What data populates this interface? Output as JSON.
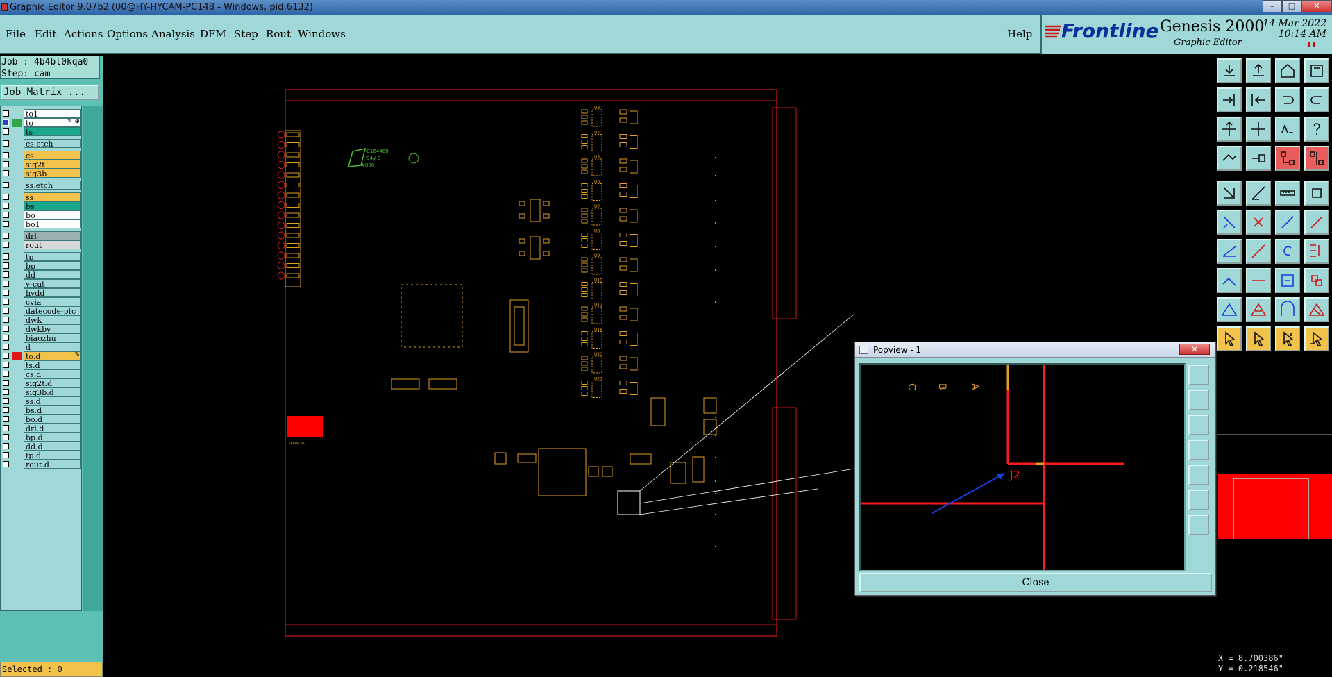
{
  "window": {
    "title": "Graphic Editor 9.07b2 (00@HY-HYCAM-PC148 - Windows, pid:6132)",
    "controls": [
      "–",
      "□",
      "✕"
    ]
  },
  "menu": {
    "items": [
      "File",
      "Edit",
      "Actions",
      "Options",
      "Analysis",
      "DFM",
      "Step",
      "Rout",
      "Windows"
    ],
    "help": "Help"
  },
  "brand": {
    "logo": "Frontline",
    "product": "Genesis 2000",
    "subtitle": "Graphic Editor",
    "date": "14 Mar 2022",
    "time": "10:14 AM"
  },
  "job": {
    "job_line": "Job : 4b4bl0kqa0",
    "step_line": "Step: cam",
    "matrix_button": "Job Matrix ..."
  },
  "layers": [
    {
      "name": "to1",
      "color": "#ffffff",
      "swatch": "",
      "checked": false,
      "gap": false
    },
    {
      "name": "to",
      "color": "#ffffff",
      "swatch": "#2fa84a",
      "checked": true,
      "gap": false,
      "edit": "✎ ⊕"
    },
    {
      "name": "ts",
      "color": "#1aa88a",
      "swatch": "",
      "checked": false,
      "gap": false
    },
    {
      "name": "cs.etch",
      "color": "#9fd8d6",
      "swatch": "",
      "checked": false,
      "gap": true
    },
    {
      "name": "cs",
      "color": "#f2c24a",
      "swatch": "",
      "checked": false,
      "gap": true
    },
    {
      "name": "sig2t",
      "color": "#f2c24a",
      "swatch": "",
      "checked": false,
      "gap": false
    },
    {
      "name": "sig3b",
      "color": "#f2c24a",
      "swatch": "",
      "checked": false,
      "gap": false
    },
    {
      "name": "ss.etch",
      "color": "#9fd8d6",
      "swatch": "",
      "checked": false,
      "gap": true
    },
    {
      "name": "ss",
      "color": "#f2c24a",
      "swatch": "",
      "checked": false,
      "gap": true
    },
    {
      "name": "bs",
      "color": "#1aa88a",
      "swatch": "",
      "checked": false,
      "gap": false
    },
    {
      "name": "bo",
      "color": "#ffffff",
      "swatch": "",
      "checked": false,
      "gap": false
    },
    {
      "name": "bo1",
      "color": "#ffffff",
      "swatch": "",
      "checked": false,
      "gap": false
    },
    {
      "name": "drl",
      "color": "#9ab0b0",
      "swatch": "",
      "checked": false,
      "gap": true
    },
    {
      "name": "rout",
      "color": "#d8d8d8",
      "swatch": "",
      "checked": false,
      "gap": false
    },
    {
      "name": "tp",
      "color": "#9fd8d6",
      "swatch": "",
      "checked": false,
      "gap": true
    },
    {
      "name": "bp",
      "color": "#9fd8d6",
      "swatch": "",
      "checked": false,
      "gap": false
    },
    {
      "name": "dd",
      "color": "#9fd8d6",
      "swatch": "",
      "checked": false,
      "gap": false
    },
    {
      "name": "v-cut",
      "color": "#9fd8d6",
      "swatch": "",
      "checked": false,
      "gap": false
    },
    {
      "name": "hydd",
      "color": "#9fd8d6",
      "swatch": "",
      "checked": false,
      "gap": false
    },
    {
      "name": "cvia",
      "color": "#9fd8d6",
      "swatch": "",
      "checked": false,
      "gap": false
    },
    {
      "name": "datecode-ptc",
      "color": "#9fd8d6",
      "swatch": "",
      "checked": false,
      "gap": false
    },
    {
      "name": "dwk",
      "color": "#9fd8d6",
      "swatch": "",
      "checked": false,
      "gap": false
    },
    {
      "name": "dwkby",
      "color": "#9fd8d6",
      "swatch": "",
      "checked": false,
      "gap": false
    },
    {
      "name": "biaozhu",
      "color": "#9fd8d6",
      "swatch": "",
      "checked": false,
      "gap": false
    },
    {
      "name": "d",
      "color": "#9fd8d6",
      "swatch": "",
      "checked": false,
      "gap": false
    },
    {
      "name": "to.d",
      "color": "#f2c24a",
      "swatch": "#e01818",
      "checked": false,
      "gap": false,
      "edit": "✎"
    },
    {
      "name": "ts.d",
      "color": "#9fd8d6",
      "swatch": "",
      "checked": false,
      "gap": false
    },
    {
      "name": "cs.d",
      "color": "#9fd8d6",
      "swatch": "",
      "checked": false,
      "gap": false
    },
    {
      "name": "sig2t.d",
      "color": "#9fd8d6",
      "swatch": "",
      "checked": false,
      "gap": false
    },
    {
      "name": "sig3b.d",
      "color": "#9fd8d6",
      "swatch": "",
      "checked": false,
      "gap": false
    },
    {
      "name": "ss.d",
      "color": "#9fd8d6",
      "swatch": "",
      "checked": false,
      "gap": false
    },
    {
      "name": "bs.d",
      "color": "#9fd8d6",
      "swatch": "",
      "checked": false,
      "gap": false
    },
    {
      "name": "bo.d",
      "color": "#9fd8d6",
      "swatch": "",
      "checked": false,
      "gap": false
    },
    {
      "name": "drl.d",
      "color": "#9fd8d6",
      "swatch": "",
      "checked": false,
      "gap": false
    },
    {
      "name": "bp.d",
      "color": "#9fd8d6",
      "swatch": "",
      "checked": false,
      "gap": false
    },
    {
      "name": "dd.d",
      "color": "#9fd8d6",
      "swatch": "",
      "checked": false,
      "gap": false
    },
    {
      "name": "tp.d",
      "color": "#9fd8d6",
      "swatch": "",
      "checked": false,
      "gap": false
    },
    {
      "name": "rout.d",
      "color": "#9fd8d6",
      "swatch": "",
      "checked": false,
      "gap": false
    }
  ],
  "status": {
    "selected": "Selected : 0"
  },
  "canvas": {
    "colors": {
      "outline": "#d01818",
      "silk": "#e0a020",
      "pad": "#ff0000",
      "highlight": "#ffffff"
    },
    "component_labels": [
      "U3",
      "U4",
      "U5",
      "U6",
      "U7",
      "U8",
      "U9",
      "U10",
      "U17",
      "U18",
      "U20",
      "U21"
    ]
  },
  "popview": {
    "title": "Popview - 1",
    "close_label": "Close",
    "labels": [
      "C",
      "B",
      "A"
    ],
    "ref": "J2",
    "colors": {
      "trace": "#ff1a1a",
      "silk": "#e0a020",
      "arrow": "#1a3de0"
    }
  },
  "toolbar": {
    "icons": [
      "open-icon",
      "save-icon",
      "home-icon",
      "stretch-icon",
      "import-icon",
      "export-icon",
      "undo-icon",
      "redo-icon",
      "zoom-fit-icon",
      "zoom-center-icon",
      "scale-1-2-icon",
      "help-icon",
      "measure-icon",
      "snap-icon",
      "layers-icon",
      "layers-alt-icon",
      "select-icon",
      "route-icon",
      "ruler-icon",
      "pad-icon",
      "connect-icon",
      "delete-node-icon",
      "add-point-icon",
      "edit-point-icon",
      "line-icon",
      "arc-icon",
      "rotate-icon",
      "text-icon",
      "join-icon",
      "cut-icon",
      "dimension-icon",
      "copy-icon",
      "triangle-icon",
      "triangle-up-icon",
      "arch-icon",
      "triangle-x-icon",
      "pointer-icon",
      "pointer-alt-icon",
      "pointer-edit-icon",
      "pointer-move-icon"
    ]
  },
  "coords": {
    "x": "X = 8.700386\"",
    "y": "Y = 0.218546\""
  }
}
